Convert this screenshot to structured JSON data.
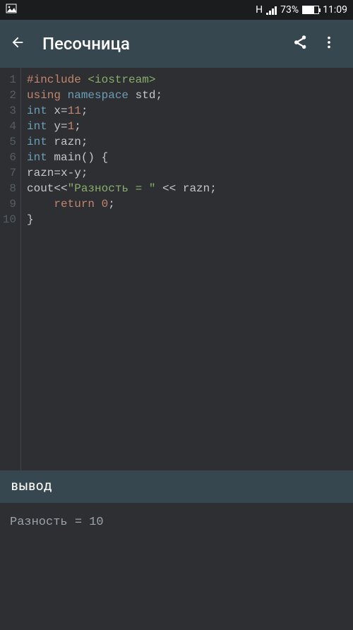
{
  "status": {
    "network_label": "H",
    "battery_pct": "73%",
    "battery_fill": 73,
    "clock": "11:09"
  },
  "appbar": {
    "title": "Песочница"
  },
  "code": {
    "lines": [
      [
        {
          "t": "pre",
          "v": "#include "
        },
        {
          "t": "inc",
          "v": "<iostream>"
        }
      ],
      [
        {
          "t": "kw",
          "v": "using "
        },
        {
          "t": "type",
          "v": "namespace "
        },
        {
          "t": "id",
          "v": "std"
        },
        {
          "t": "punct",
          "v": ";"
        }
      ],
      [
        {
          "t": "type",
          "v": "int "
        },
        {
          "t": "id",
          "v": "x"
        },
        {
          "t": "punct",
          "v": "="
        },
        {
          "t": "num",
          "v": "11"
        },
        {
          "t": "punct",
          "v": ";"
        }
      ],
      [
        {
          "t": "type",
          "v": "int "
        },
        {
          "t": "id",
          "v": "y"
        },
        {
          "t": "punct",
          "v": "="
        },
        {
          "t": "num",
          "v": "1"
        },
        {
          "t": "punct",
          "v": ";"
        }
      ],
      [
        {
          "t": "type",
          "v": "int "
        },
        {
          "t": "id",
          "v": "razn"
        },
        {
          "t": "punct",
          "v": ";"
        }
      ],
      [
        {
          "t": "type",
          "v": "int "
        },
        {
          "t": "id",
          "v": "main"
        },
        {
          "t": "punct",
          "v": "() {"
        }
      ],
      [
        {
          "t": "id",
          "v": "razn"
        },
        {
          "t": "punct",
          "v": "="
        },
        {
          "t": "id",
          "v": "x"
        },
        {
          "t": "punct",
          "v": "-"
        },
        {
          "t": "id",
          "v": "y"
        },
        {
          "t": "punct",
          "v": ";"
        }
      ],
      [
        {
          "t": "id",
          "v": "cout"
        },
        {
          "t": "punct",
          "v": "<<"
        },
        {
          "t": "str",
          "v": "\"Разность = \""
        },
        {
          "t": "punct",
          "v": " << "
        },
        {
          "t": "id",
          "v": "razn"
        },
        {
          "t": "punct",
          "v": ";"
        }
      ],
      [
        {
          "t": "id",
          "v": "    "
        },
        {
          "t": "kw",
          "v": "return "
        },
        {
          "t": "num",
          "v": "0"
        },
        {
          "t": "punct",
          "v": ";"
        }
      ],
      [
        {
          "t": "punct",
          "v": "}"
        }
      ]
    ]
  },
  "output": {
    "header": "ВЫВОД",
    "text": "Разность = 10"
  }
}
